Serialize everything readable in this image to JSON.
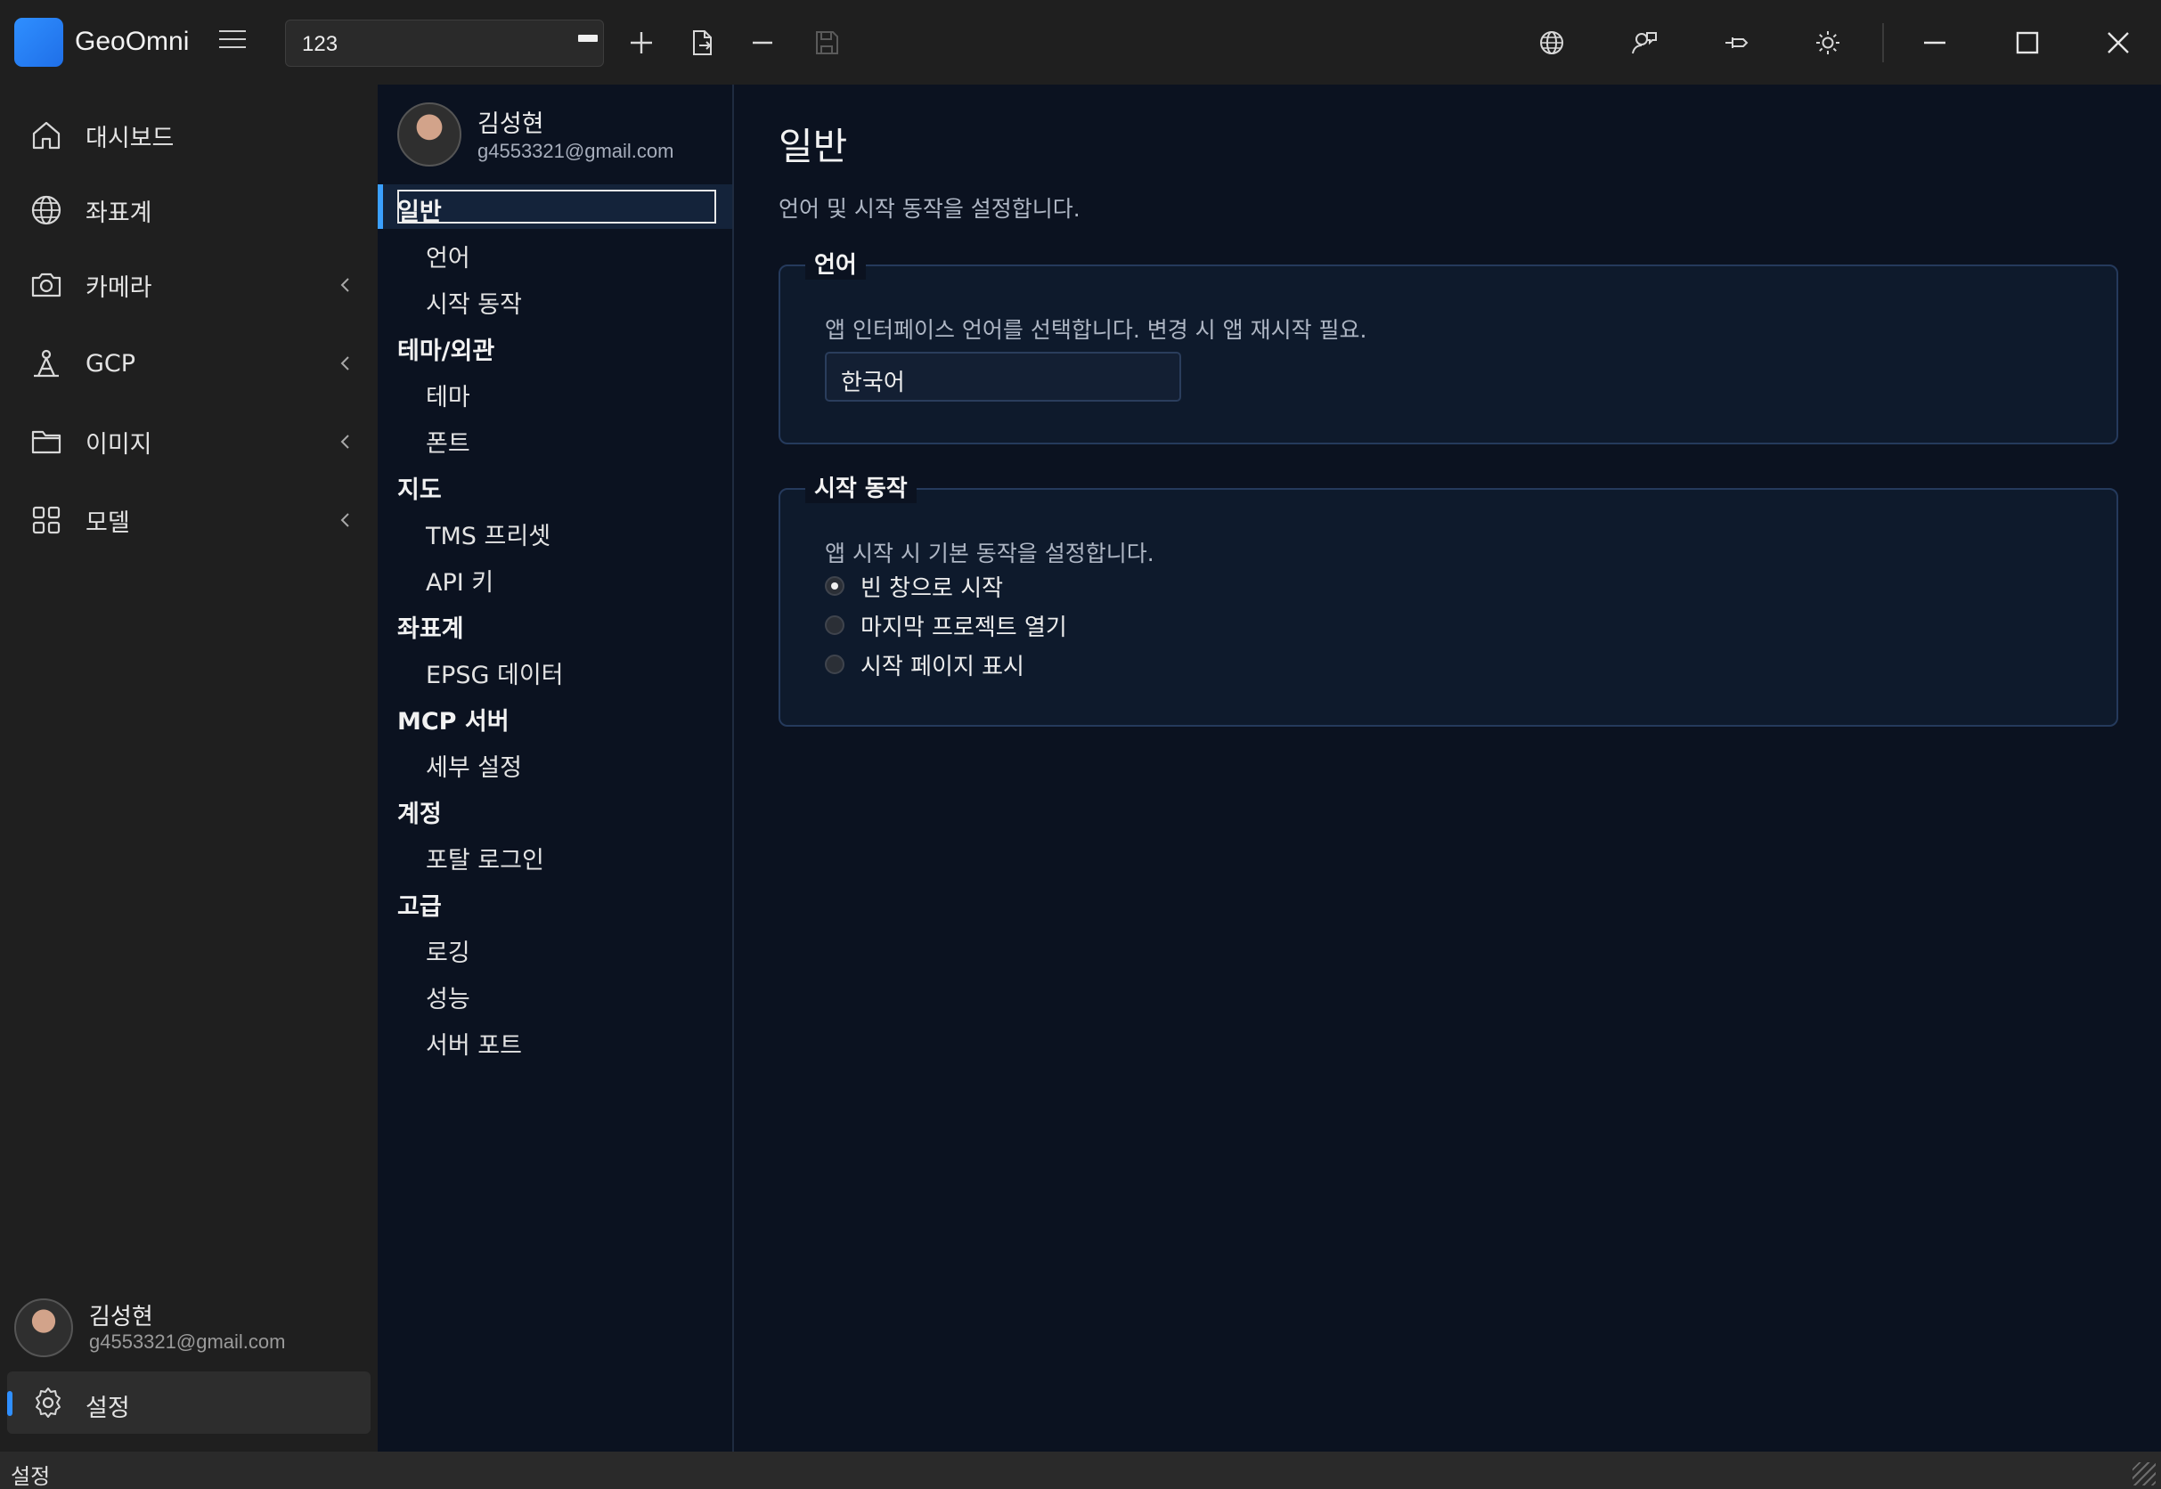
{
  "app": {
    "name": "GeoOmni"
  },
  "toolbar": {
    "project_value": "123"
  },
  "nav": {
    "items": [
      {
        "label": "대시보드",
        "icon": "home-icon"
      },
      {
        "label": "좌표계",
        "icon": "globe-icon"
      },
      {
        "label": "카메라",
        "icon": "camera-icon",
        "expandable": true
      },
      {
        "label": "GCP",
        "icon": "gcp-pin-icon",
        "expandable": true
      },
      {
        "label": "이미지",
        "icon": "folder-icon",
        "expandable": true
      },
      {
        "label": "모델",
        "icon": "grid-icon",
        "expandable": true
      }
    ],
    "user": {
      "name": "김성현",
      "email": "g4553321@gmail.com"
    },
    "settings_label": "설정"
  },
  "tree": {
    "user": {
      "name": "김성현",
      "email": "g4553321@gmail.com"
    },
    "selected": "일반",
    "sections": [
      {
        "title": "일반",
        "items": [
          "언어",
          "시작 동작"
        ]
      },
      {
        "title": "테마/외관",
        "items": [
          "테마",
          "폰트"
        ]
      },
      {
        "title": "지도",
        "items": [
          "TMS 프리셋",
          "API 키"
        ]
      },
      {
        "title": "좌표계",
        "items": [
          "EPSG 데이터"
        ]
      },
      {
        "title": "MCP 서버",
        "items": [
          "세부 설정"
        ]
      },
      {
        "title": "계정",
        "items": [
          "포탈 로그인"
        ]
      },
      {
        "title": "고급",
        "items": [
          "로깅",
          "성능",
          "서버 포트"
        ]
      }
    ]
  },
  "content": {
    "title": "일반",
    "description": "언어 및 시작 동작을 설정합니다.",
    "language_group": {
      "legend": "언어",
      "description": "앱 인터페이스 언어를 선택합니다. 변경 시 앱 재시작 필요.",
      "selected": "한국어"
    },
    "startup_group": {
      "legend": "시작 동작",
      "description": "앱 시작 시 기본 동작을 설정합니다.",
      "options": [
        {
          "label": "빈 창으로 시작",
          "checked": true
        },
        {
          "label": "마지막 프로젝트 열기",
          "checked": false
        },
        {
          "label": "시작 페이지 표시",
          "checked": false
        }
      ]
    }
  },
  "statusbar": {
    "text": "설정"
  },
  "colors": {
    "accent": "#2f8fff",
    "content_bg": "#0b1220",
    "chrome_bg": "#1f1f1f"
  }
}
